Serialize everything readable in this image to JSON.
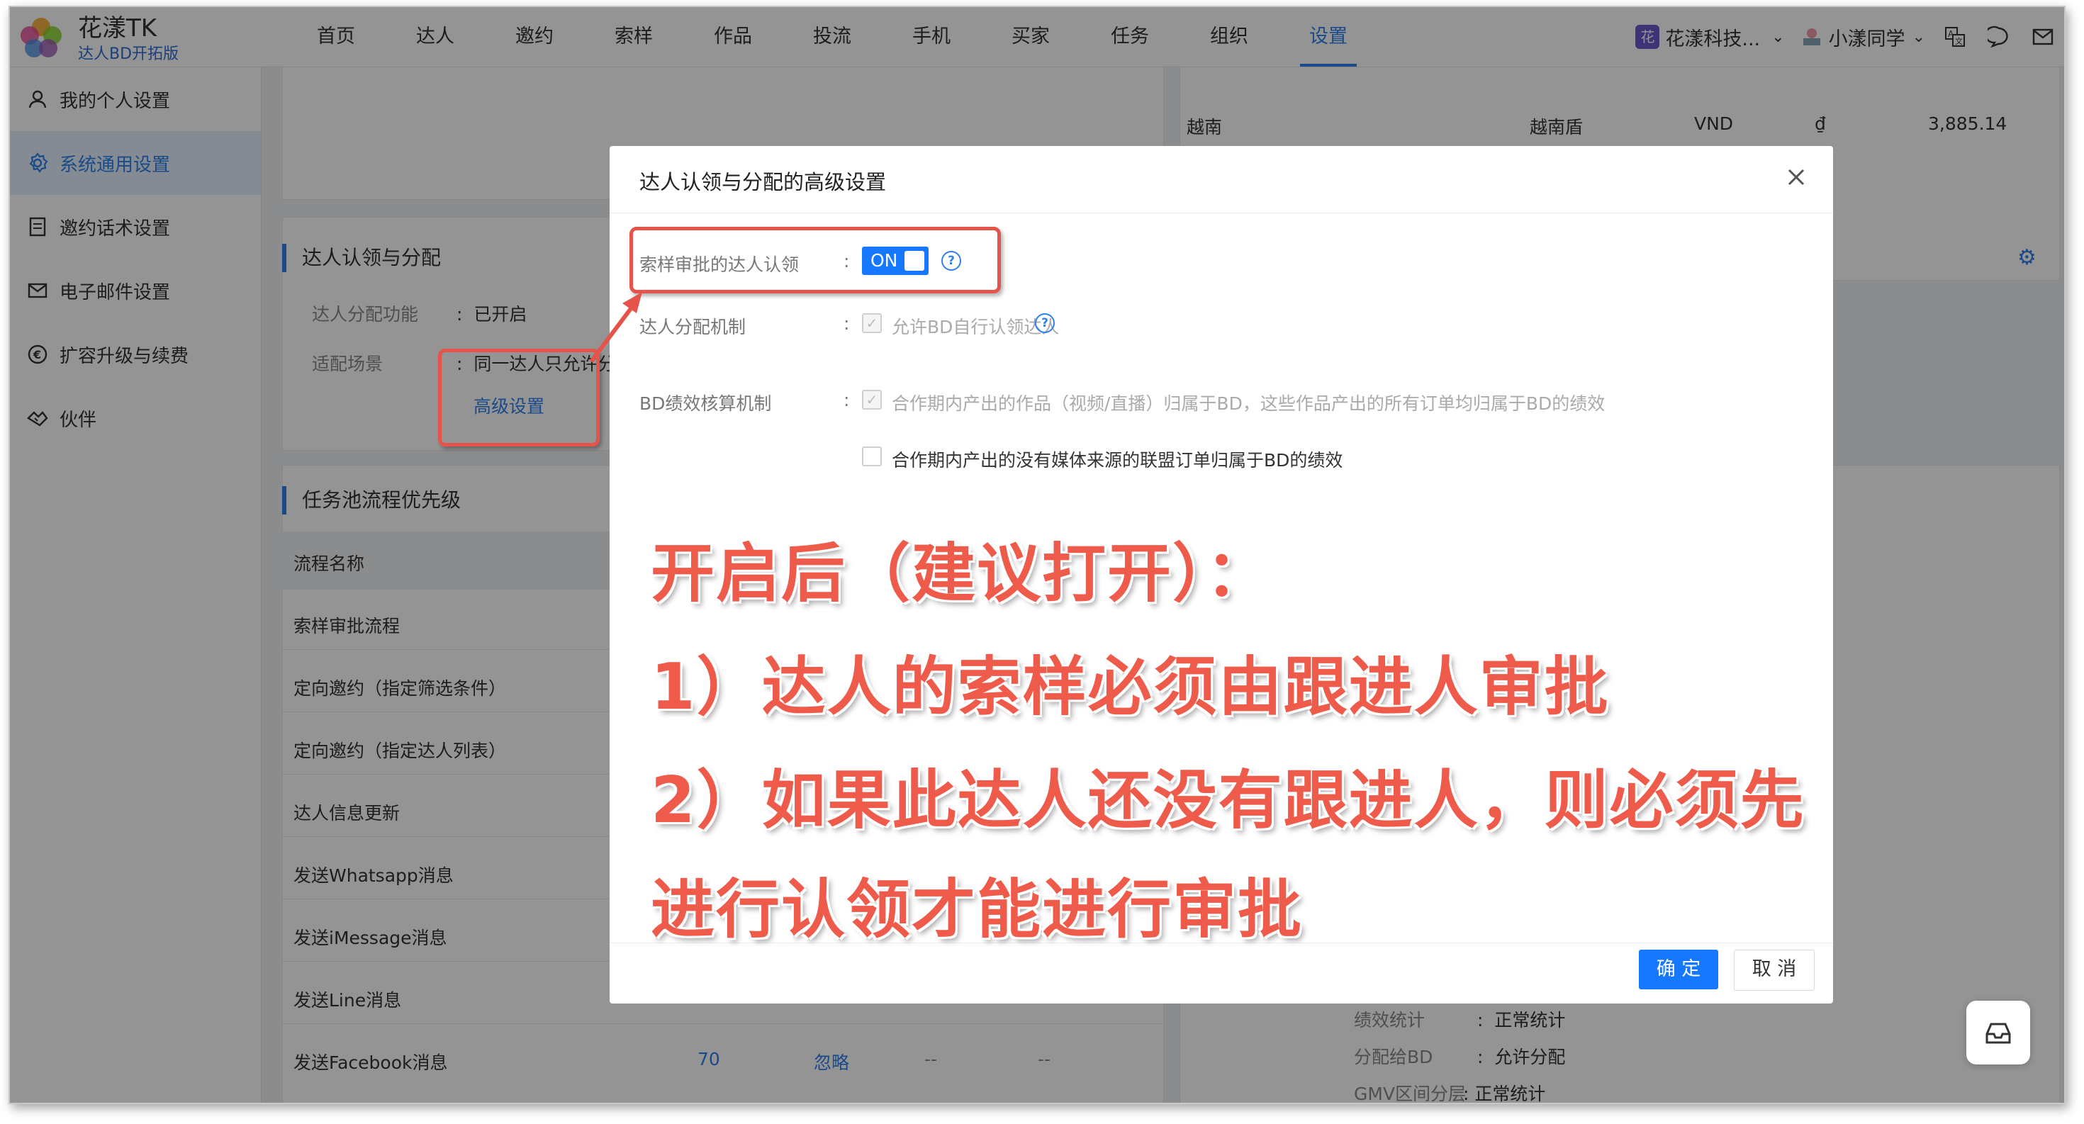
{
  "app": {
    "name": "花漾TK",
    "edition": "达人BD开拓版"
  },
  "nav": [
    "首页",
    "达人",
    "邀约",
    "索样",
    "作品",
    "投流",
    "手机",
    "买家",
    "任务",
    "组织",
    "设置"
  ],
  "nav_active": "设置",
  "top_right": {
    "org": "花漾科技...",
    "org_badge": "花",
    "user": "小漾同学"
  },
  "sidebar": [
    {
      "label": "我的个人设置",
      "icon": "user-icon"
    },
    {
      "label": "系统通用设置",
      "icon": "gear-icon",
      "active": true
    },
    {
      "label": "邀约话术设置",
      "icon": "document-icon"
    },
    {
      "label": "电子邮件设置",
      "icon": "mail-icon"
    },
    {
      "label": "扩容升级与续费",
      "icon": "euro-circle-icon"
    },
    {
      "label": "伙伴",
      "icon": "handshake-icon"
    }
  ],
  "background": {
    "claim_section": {
      "title": "达人认领与分配",
      "fields": [
        {
          "label": "达人分配功能",
          "value": "已开启"
        },
        {
          "label": "适配场景",
          "value": "同一达人只允许分"
        }
      ],
      "advanced_link": "高级设置"
    },
    "currency_row": {
      "country": "越南",
      "currency": "越南盾",
      "code": "VND",
      "symbol": "₫",
      "rate": "3,885.14"
    },
    "task_section": {
      "title": "任务池流程优先级",
      "header": "流程名称",
      "rows": [
        "索样审批流程",
        "定向邀约（指定筛选条件）",
        "定向邀约（指定达人列表）",
        "达人信息更新",
        "发送Whatsapp消息",
        "发送iMessage消息",
        "发送Line消息",
        "发送Facebook消息"
      ],
      "last_row_priority": "70",
      "last_row_action": "忽略",
      "last_row_dashes": [
        "--",
        "--"
      ]
    },
    "stats": [
      {
        "label": "绩效统计",
        "value": "正常统计"
      },
      {
        "label": "分配给BD",
        "value": "允许分配"
      },
      {
        "label": "GMV区间分层",
        "value": "正常统计"
      }
    ]
  },
  "modal": {
    "title": "达人认领与分配的高级设置",
    "fields": [
      {
        "label": "索样审批的达人认领",
        "toggle": "ON"
      },
      {
        "label": "达人分配机制",
        "option": "允许BD自行认领达人"
      },
      {
        "label": "BD绩效核算机制",
        "options": [
          "合作期内产出的作品（视频/直播）归属于BD，这些作品产出的所有订单均归属于BD的绩效",
          "合作期内产出的没有媒体来源的联盟订单归属于BD的绩效"
        ]
      }
    ],
    "ok": "确 定",
    "cancel": "取 消"
  },
  "annotation": {
    "lines": [
      "开启后（建议打开）：",
      "1）达人的索样必须由跟进人审批",
      "2）如果此达人还没有跟进人，则必须先",
      "进行认领才能进行审批"
    ],
    "color": "#ef5b4b"
  }
}
